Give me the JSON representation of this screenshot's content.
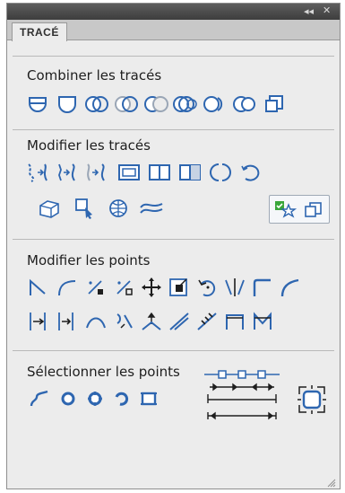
{
  "panel": {
    "tab_label": "TRACÉ",
    "collapse_glyph": "◂◂",
    "close_glyph": "✕"
  },
  "sections": {
    "combine": {
      "title": "Combiner les tracés"
    },
    "modify_paths": {
      "title": "Modifier les tracés"
    },
    "modify_points": {
      "title": "Modifier les points"
    },
    "select_points": {
      "title": "Sélectionner les points"
    }
  },
  "colors": {
    "accent_blue": "#2e66b0",
    "accent_green": "#3aa63a",
    "panel_bg": "#ececec"
  }
}
